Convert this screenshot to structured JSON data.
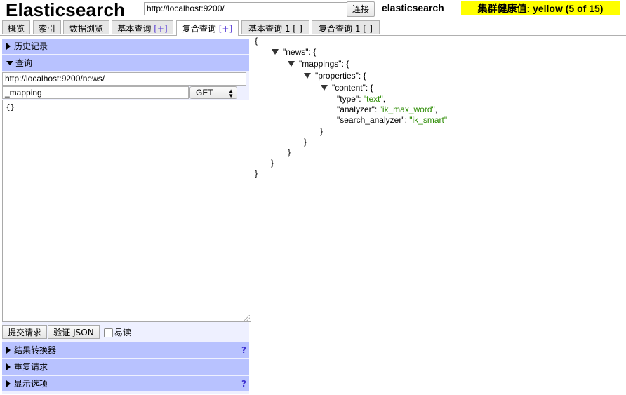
{
  "header": {
    "logo": "Elasticsearch",
    "url_value": "http://localhost:9200/",
    "connect_label": "连接",
    "cluster_name": "elasticsearch",
    "health_text": "集群健康值: yellow (5 of 15)",
    "health_color": "#ffff00"
  },
  "tabs": [
    {
      "label": "概览",
      "plus": ""
    },
    {
      "label": "索引",
      "plus": ""
    },
    {
      "label": "数据浏览",
      "plus": ""
    },
    {
      "label": "基本查询 ",
      "plus": "[+]"
    },
    {
      "label": "复合查询 ",
      "plus": "[+]"
    },
    {
      "label": "基本查询 1 [-]",
      "plus": ""
    },
    {
      "label": "复合查询 1 [-]",
      "plus": ""
    }
  ],
  "left": {
    "history_label": "历史记录",
    "query_label": "查询",
    "query_url": "http://localhost:9200/news/",
    "path_value": "_mapping",
    "method_value": "GET",
    "body_value": "{}",
    "submit_label": "提交请求",
    "validate_label": "验证 JSON",
    "pretty_label": "易读",
    "transformer_label": "结果转换器",
    "repeat_label": "重复请求",
    "display_label": "显示选项",
    "help_glyph": "?"
  },
  "json_view": {
    "open_brace": "{",
    "news_key": "\"news\"",
    "mappings_key": "\"mappings\"",
    "properties_key": "\"properties\"",
    "content_key": "\"content\"",
    "type_key": "\"type\"",
    "type_val": "\"text\"",
    "analyzer_key": "\"analyzer\"",
    "analyzer_val": "\"ik_max_word\"",
    "search_analyzer_key": "\"search_analyzer\"",
    "search_analyzer_val": "\"ik_smart\"",
    "close_brace": "}",
    "colon_open": ": {",
    "colon": ": ",
    "comma": ","
  }
}
